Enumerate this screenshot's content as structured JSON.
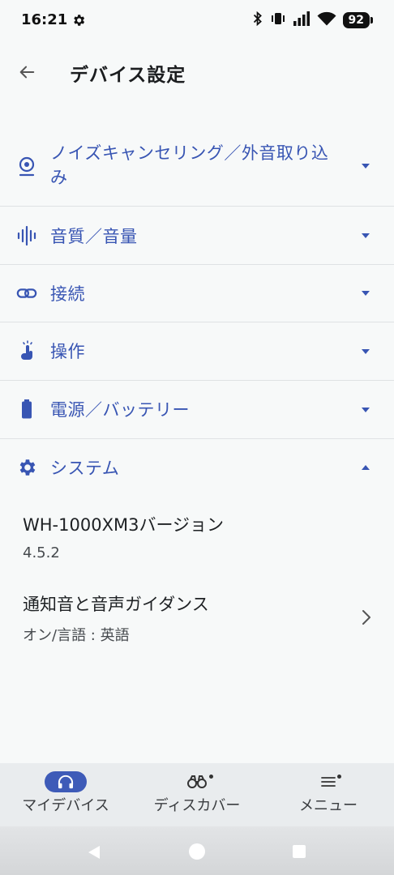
{
  "status": {
    "time": "16:21",
    "battery": "92"
  },
  "header": {
    "title": "デバイス設定"
  },
  "sections": [
    {
      "label_line1": "ノイズキャンセリング／外音取り込",
      "label_line2": "み",
      "icon": "noise-cancel-icon",
      "expanded": false
    },
    {
      "label": "音質／音量",
      "icon": "sound-wave-icon",
      "expanded": false
    },
    {
      "label": "接続",
      "icon": "link-icon",
      "expanded": false
    },
    {
      "label": "操作",
      "icon": "touch-icon",
      "expanded": false
    },
    {
      "label": "電源／バッテリー",
      "icon": "battery-icon",
      "expanded": false
    },
    {
      "label": "システム",
      "icon": "gear-icon",
      "expanded": true
    }
  ],
  "system_items": [
    {
      "title": "WH-1000XM3バージョン",
      "value": "4.5.2"
    },
    {
      "title": "通知音と音声ガイダンス",
      "value": "オン/言語 : 英語"
    }
  ],
  "bottom_nav": [
    {
      "label": "マイデバイス",
      "icon": "headphones-icon",
      "active": true
    },
    {
      "label": "ディスカバー",
      "icon": "binoculars-icon",
      "active": false
    },
    {
      "label": "メニュー",
      "icon": "menu-icon",
      "active": false
    }
  ],
  "colors": {
    "accent": "#3855b3",
    "active_pill": "#3e5bb8",
    "divider": "#dfe2e4",
    "background": "#f7f9f9"
  }
}
